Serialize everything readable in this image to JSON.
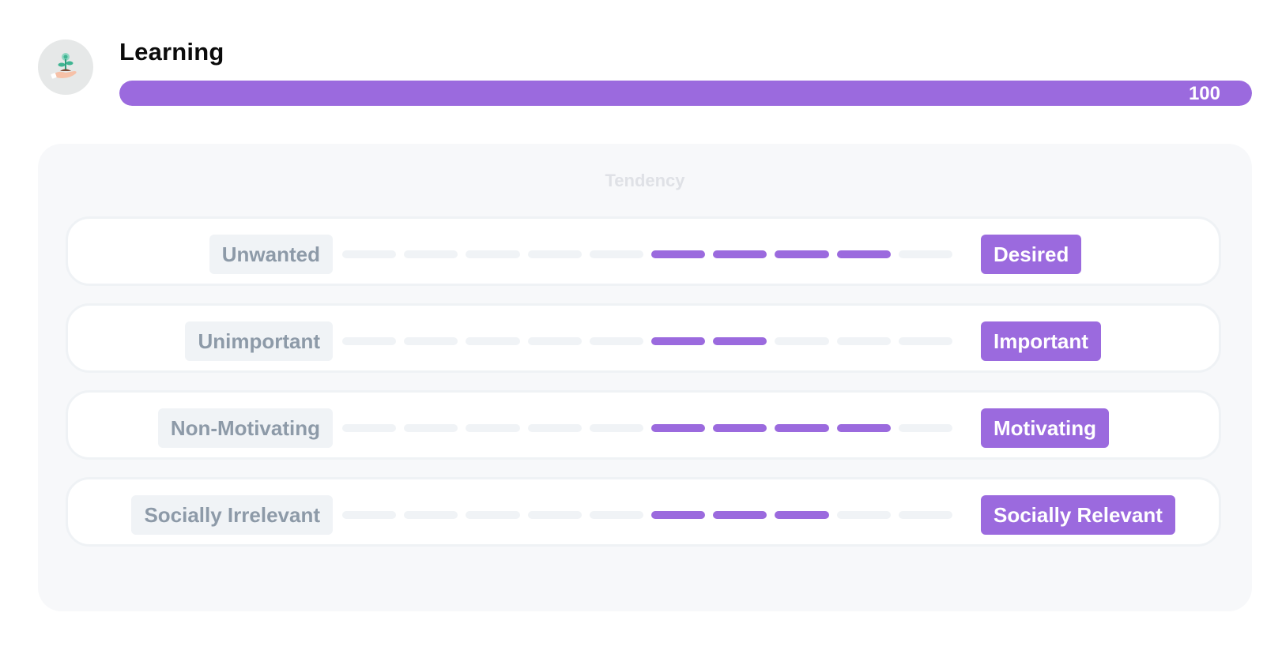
{
  "header": {
    "icon": "hand-holding-plant-icon",
    "title": "Learning",
    "progress": {
      "value": 100,
      "max": 100,
      "label": "100",
      "color": "#9b6ade"
    }
  },
  "panel": {
    "title": "Tendency",
    "segments_per_row": 10,
    "center_index": 5,
    "rows": [
      {
        "left": "Unwanted",
        "right": "Desired",
        "filled_right_of_center": 4
      },
      {
        "left": "Unimportant",
        "right": "Important",
        "filled_right_of_center": 2
      },
      {
        "left": "Non-Motivating",
        "right": "Motivating",
        "filled_right_of_center": 4
      },
      {
        "left": "Socially Irrelevant",
        "right": "Socially Relevant",
        "filled_right_of_center": 3
      }
    ]
  },
  "colors": {
    "accent": "#9b6ade",
    "muted_label_bg": "#f0f3f6",
    "muted_label_text": "#8d9aa8",
    "panel_bg": "#f7f8fa"
  }
}
